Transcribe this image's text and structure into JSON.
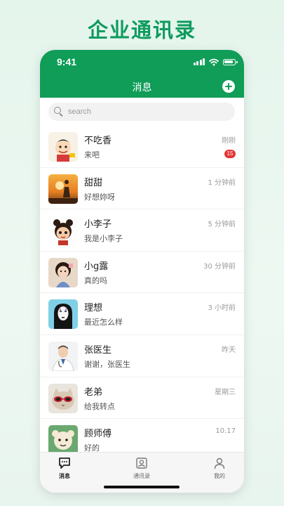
{
  "headline": "企业通讯录",
  "status_bar": {
    "time": "9:41"
  },
  "nav": {
    "title": "消息",
    "add_icon": "plus-circle-icon"
  },
  "search": {
    "placeholder": "search",
    "icon": "search-icon"
  },
  "conversations": [
    {
      "name": "不吃香",
      "message": "来吧",
      "time": "刚刚",
      "badge": "15",
      "avatar": "cartoon-boy"
    },
    {
      "name": "甜甜",
      "message": "好想妳呀",
      "time": "1 分钟前",
      "avatar": "sunset-silhouette"
    },
    {
      "name": "小李子",
      "message": "我是小李子",
      "time": "5 分钟前",
      "avatar": "cartoon-girl"
    },
    {
      "name": "小g露",
      "message": "真的吗",
      "time": "30 分钟前",
      "avatar": "girl-photo"
    },
    {
      "name": "理想",
      "message": "最近怎么样",
      "time": "3 小时前",
      "avatar": "no-face-spirit"
    },
    {
      "name": "张医生",
      "message": "谢谢，张医生",
      "time": "昨天",
      "avatar": "doctor"
    },
    {
      "name": "老弟",
      "message": "给我转点",
      "time": "星期三",
      "avatar": "cat-sunglasses"
    },
    {
      "name": "顾师傅",
      "message": "好的",
      "time": "10.17",
      "avatar": "green-cartoon"
    }
  ],
  "tabs": [
    {
      "label": "消息",
      "icon": "chat-bubble-icon",
      "active": true
    },
    {
      "label": "通讯录",
      "icon": "contacts-icon",
      "active": false
    },
    {
      "label": "我的",
      "icon": "person-icon",
      "active": false
    }
  ],
  "colors": {
    "brand_green": "#0f9d58",
    "headline_green": "#0f9b5f",
    "badge_red": "#e33535"
  }
}
